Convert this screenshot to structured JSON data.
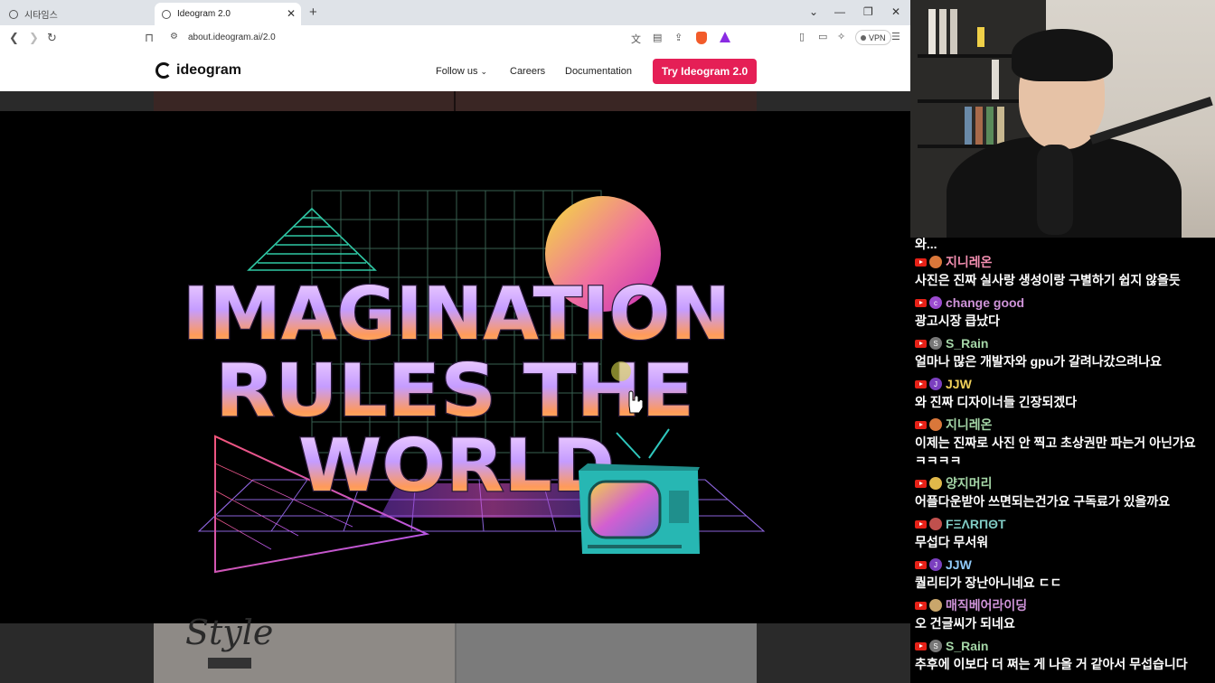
{
  "browser": {
    "tabs": [
      {
        "title": "시타임스",
        "active": false
      },
      {
        "title": "Ideogram 2.0",
        "active": true
      }
    ],
    "new_tab_icon": "plus-icon",
    "address": "about.ideogram.ai/2.0",
    "vpn_label": "VPN"
  },
  "site": {
    "logo_text": "ideogram",
    "nav": {
      "follow_us": "Follow us",
      "careers": "Careers",
      "documentation": "Documentation"
    },
    "cta_label": "Try Ideogram 2.0"
  },
  "artwork": {
    "line1": "IMAGINATION",
    "line2": "RULES THE",
    "line3": "WORLD"
  },
  "gallery_peek": {
    "style_word": "Style"
  },
  "chat": {
    "truncated_top": "와...",
    "messages": [
      {
        "user": "지니레온",
        "user_color": "#f48fb1",
        "avatar_color": "#d9773a",
        "avatar_letter": "",
        "text": "사진은 진짜 실사랑 생성이랑 구별하기 쉽지 않을듯"
      },
      {
        "user": "change good",
        "user_color": "#ce93d8",
        "avatar_color": "#9c4bd0",
        "avatar_letter": "c",
        "text": "광고시장 큽났다"
      },
      {
        "user": "S_Rain",
        "user_color": "#a5d6a7",
        "avatar_color": "#777777",
        "avatar_letter": "S",
        "text": "얼마나 많은 개발자와 gpu가 갈려나갔으려나요"
      },
      {
        "user": "JJW",
        "user_color": "#f0d05a",
        "avatar_color": "#7b3fbf",
        "avatar_letter": "J",
        "text": "와 진짜 디자이너들 긴장되겠다"
      },
      {
        "user": "지니레온",
        "user_color": "#a5d6a7",
        "avatar_color": "#d9773a",
        "avatar_letter": "",
        "text": "이제는 진짜로 사진 안 찍고 초상권만 파는거 아닌가요",
        "text2": "ㅋㅋㅋㅋ"
      },
      {
        "user": "양지머리",
        "user_color": "#a5d6a7",
        "avatar_color": "#e0b84a",
        "avatar_letter": "",
        "text": "어플다운받아 쓰면되는건가요 구독료가 있을까요"
      },
      {
        "user": "FΞΛRΠΘT",
        "user_color": "#80cbc4",
        "avatar_color": "#c0504d",
        "avatar_letter": "",
        "text": "무섭다 무서워"
      },
      {
        "user": "JJW",
        "user_color": "#90caf9",
        "avatar_color": "#7b3fbf",
        "avatar_letter": "J",
        "text": "퀄리티가 장난아니네요 ㄷㄷ"
      },
      {
        "user": "매직베어라이딩",
        "user_color": "#ce93d8",
        "avatar_color": "#c9a66b",
        "avatar_letter": "",
        "text": "오 건글씨가 되네요"
      },
      {
        "user": "S_Rain",
        "user_color": "#a5d6a7",
        "avatar_color": "#777777",
        "avatar_letter": "S",
        "text": "추후에 이보다 더 쩌는 게 나올 거 같아서 무섭습니다"
      }
    ]
  }
}
